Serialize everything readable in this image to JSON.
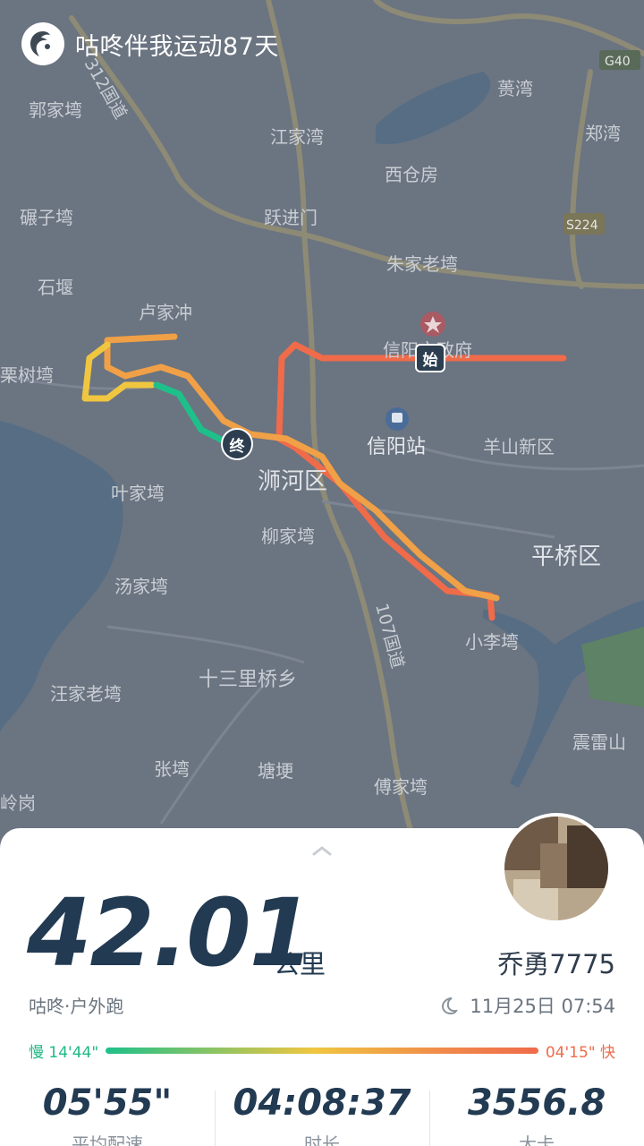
{
  "header": {
    "title": "咕咚伴我运动87天",
    "logo_icon": "codoon-logo-icon"
  },
  "map": {
    "places": [
      "郭家塆",
      "江家湾",
      "蒉湾",
      "郑湾",
      "西仓房",
      "碾子塆",
      "跃进门",
      "石堰",
      "朱家老塆",
      "卢家冲",
      "信阳市政府",
      "栗树塆",
      "信阳站",
      "羊山新区",
      "浉河区",
      "叶家塆",
      "柳家塆",
      "平桥区",
      "汤家塆",
      "小李塆",
      "十三里桥乡",
      "汪家老塆",
      "震雷山",
      "张塆",
      "塘埂",
      "傅家塆",
      "岭岗",
      "卢家冲"
    ],
    "roads": [
      "312国道",
      "107国道",
      "G40",
      "S224"
    ],
    "start_marker": "始",
    "end_marker": "终"
  },
  "summary": {
    "distance_value": "42.01",
    "distance_unit": "公里",
    "username": "乔勇7775",
    "sport_type": "咕咚·户外跑",
    "datetime": "11月25日 07:54",
    "pace_slow_label": "慢 14'44\"",
    "pace_fast_label": "04'15\" 快"
  },
  "stats": [
    {
      "value": "05'55\"",
      "label": "平均配速"
    },
    {
      "value": "04:08:37",
      "label": "时长"
    },
    {
      "value": "3556.8",
      "label": "大卡"
    }
  ],
  "colors": {
    "slow": "#1ec08a",
    "medium": "#f0c640",
    "fast": "#ef6b4a",
    "text_dark": "#223a52"
  }
}
